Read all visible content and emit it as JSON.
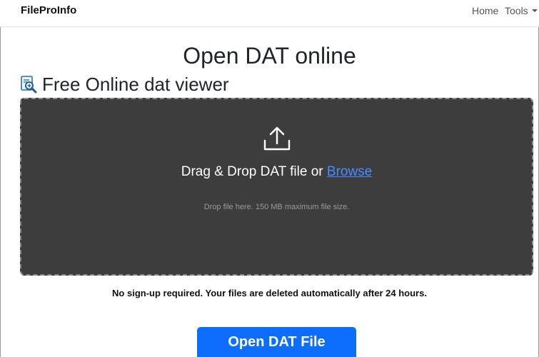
{
  "navbar": {
    "brand": "FileProInfo",
    "home_label": "Home",
    "tools_label": "Tools"
  },
  "main": {
    "title": "Open DAT online",
    "subtitle": "Free Online dat viewer",
    "subtitle_icon": "magnifier-document-icon"
  },
  "dropzone": {
    "icon": "upload-icon",
    "text": "Drag & Drop DAT file or",
    "browse_label": "Browse",
    "hint": "Drop file here. 150 MB maximum file size.",
    "background_color": "#3d3d3d"
  },
  "notice": "No sign-up required. Your files are deleted automatically after 24 hours.",
  "action": {
    "open_label": "Open DAT File",
    "color": "#0d6efd"
  }
}
